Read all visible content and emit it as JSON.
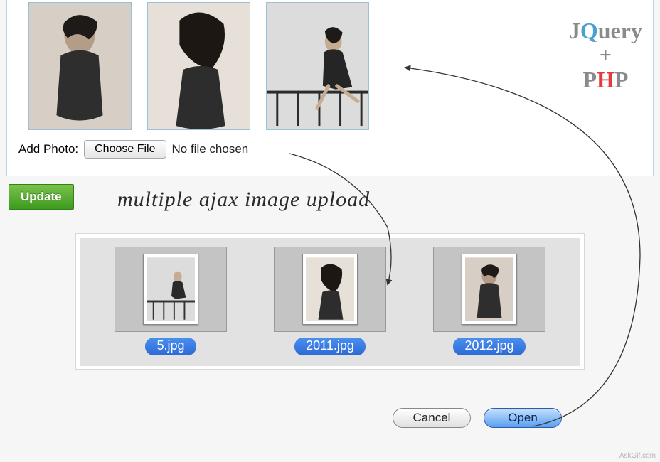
{
  "form": {
    "add_photo_label": "Add Photo:",
    "choose_file_label": "Choose File",
    "no_file_text": "No file chosen",
    "update_label": "Update"
  },
  "caption": "multiple ajax image upload",
  "logo": {
    "j": "J",
    "query_q": "Q",
    "query_rest": "uery",
    "plus": "+",
    "p1": "P",
    "h": "H",
    "p2": "P"
  },
  "chooser": {
    "files": [
      {
        "name": "5.jpg"
      },
      {
        "name": "2011.jpg"
      },
      {
        "name": "2012.jpg"
      }
    ],
    "cancel_label": "Cancel",
    "open_label": "Open"
  },
  "watermark": "AskGif.com"
}
